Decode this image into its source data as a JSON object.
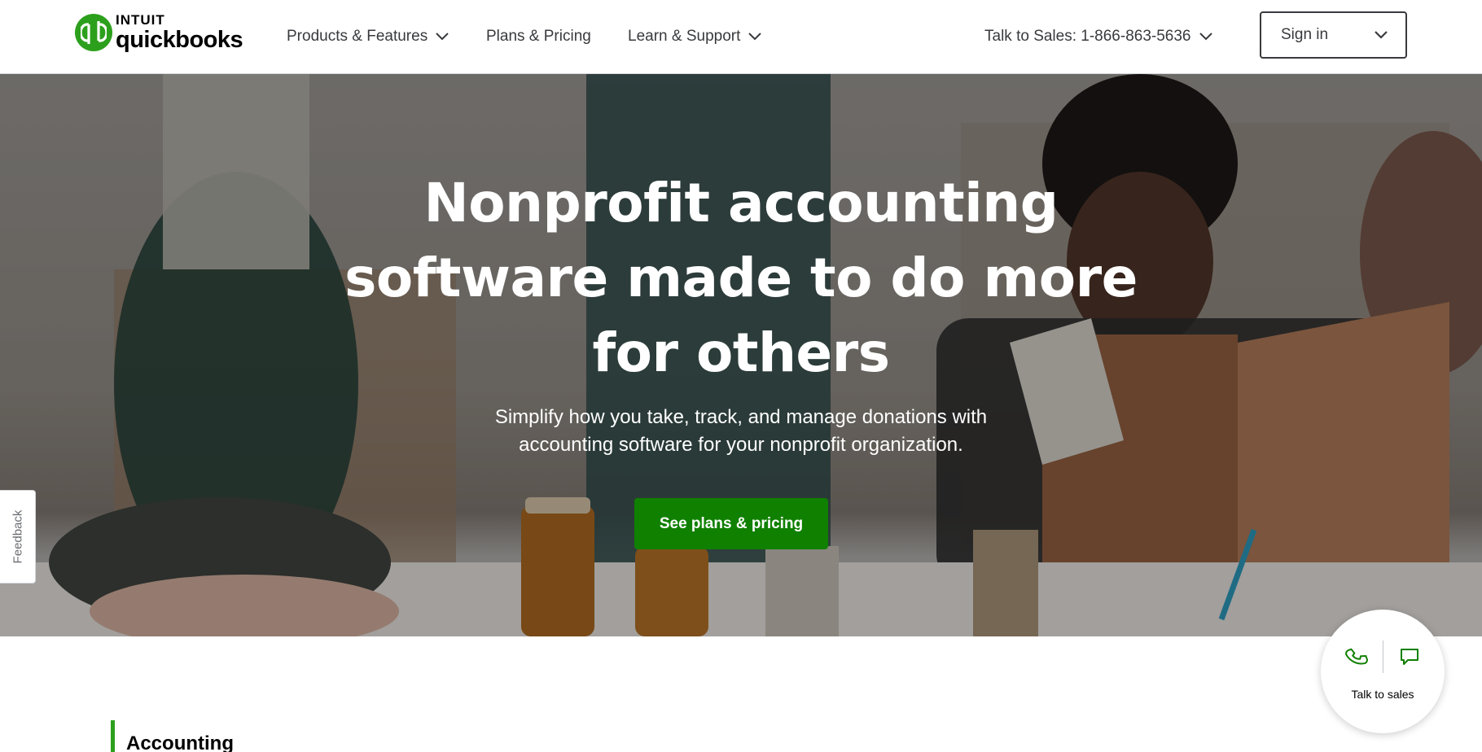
{
  "header": {
    "logo": {
      "intuit": "INTUIT",
      "product": "quickbooks"
    },
    "nav": {
      "products": "Products & Features",
      "plans": "Plans & Pricing",
      "learn": "Learn & Support",
      "sales": "Talk to Sales: 1-866-863-5636"
    },
    "signin": "Sign in"
  },
  "hero": {
    "title": "Nonprofit accounting software made to do more for others",
    "subtitle": "Simplify how you take, track, and manage donations with accounting software for your nonprofit organization.",
    "cta": "See plans & pricing"
  },
  "feedback": "Feedback",
  "section": {
    "title": "Accounting"
  },
  "talk_widget": {
    "label": "Talk to sales",
    "icons": [
      "phone-icon",
      "chat-icon"
    ]
  },
  "colors": {
    "brand_green": "#2ca01c",
    "cta_green": "#108000",
    "text": "#393a3d"
  }
}
